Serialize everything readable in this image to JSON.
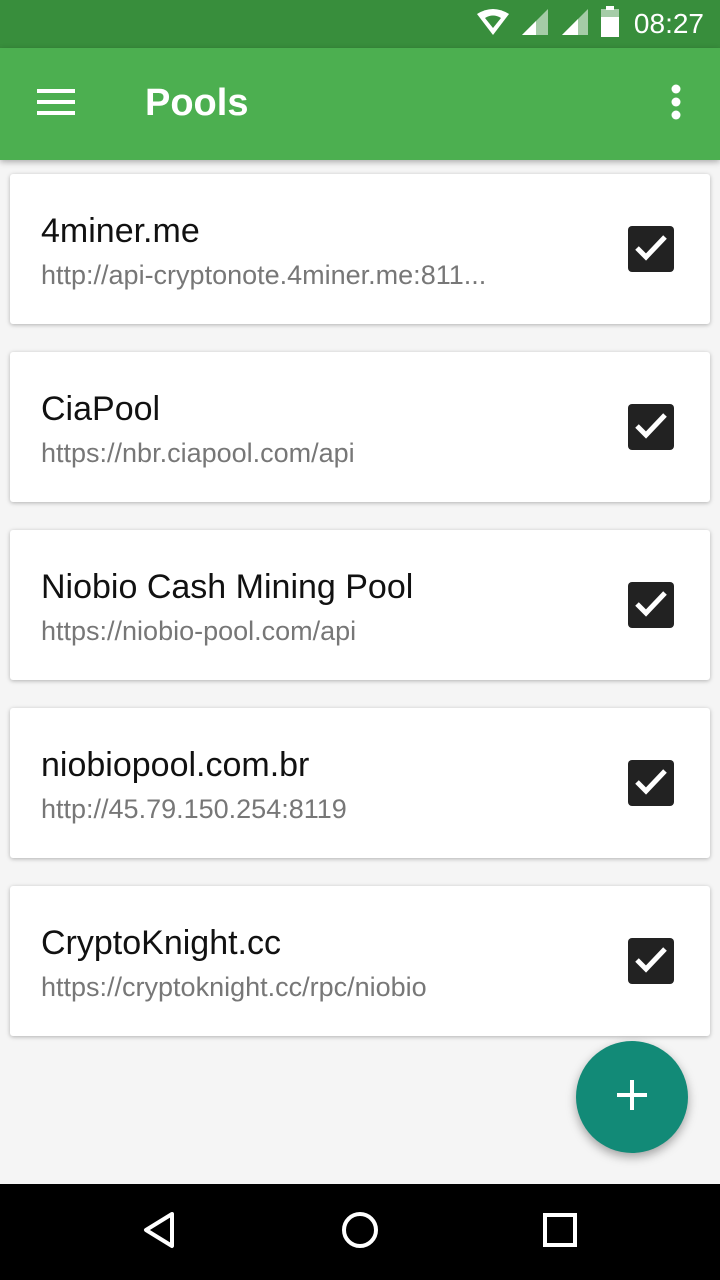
{
  "status_bar": {
    "time": "08:27"
  },
  "app_bar": {
    "title": "Pools"
  },
  "pools": [
    {
      "name": "4miner.me",
      "url": "http://api-cryptonote.4miner.me:811...",
      "checked": true
    },
    {
      "name": "CiaPool",
      "url": "https://nbr.ciapool.com/api",
      "checked": true
    },
    {
      "name": "Niobio Cash Mining Pool",
      "url": "https://niobio-pool.com/api",
      "checked": true
    },
    {
      "name": "niobiopool.com.br",
      "url": "http://45.79.150.254:8119",
      "checked": true
    },
    {
      "name": "CryptoKnight.cc",
      "url": "https://cryptoknight.cc/rpc/niobio",
      "checked": true
    }
  ],
  "colors": {
    "status_bar": "#388e3c",
    "app_bar": "#4caf50",
    "fab": "#128a77"
  },
  "icons": {
    "menu": "menu-icon",
    "overflow": "more-vert-icon",
    "add": "add-icon",
    "back": "back-icon",
    "home": "home-icon",
    "recents": "recents-icon",
    "wifi": "wifi-icon",
    "signal": "signal-icon",
    "battery": "battery-icon",
    "checkbox": "checkbox-checked-icon"
  }
}
